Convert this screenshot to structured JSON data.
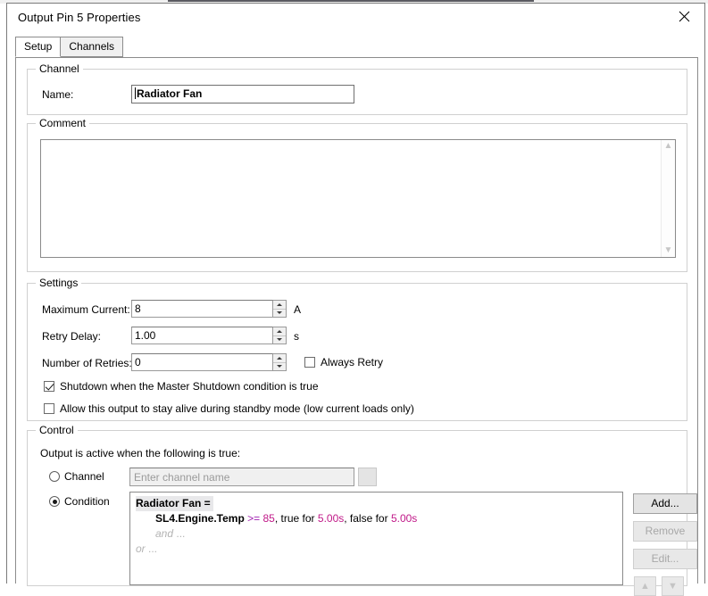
{
  "window": {
    "title": "Output Pin 5 Properties",
    "close_icon": "close-icon"
  },
  "tabs": [
    {
      "label": "Setup",
      "active": true
    },
    {
      "label": "Channels",
      "active": false
    }
  ],
  "channel_group": {
    "legend": "Channel",
    "name_label": "Name:",
    "name_value": "Radiator Fan"
  },
  "comment_group": {
    "legend": "Comment",
    "value": "",
    "scroll_up_icon": "chevron-up-icon",
    "scroll_down_icon": "chevron-down-icon"
  },
  "settings_group": {
    "legend": "Settings",
    "max_current_label": "Maximum Current:",
    "max_current_value": "8",
    "max_current_unit": "A",
    "retry_delay_label": "Retry Delay:",
    "retry_delay_value": "1.00",
    "retry_delay_unit": "s",
    "retries_label": "Number of Retries:",
    "retries_value": "0",
    "always_retry_label": "Always Retry",
    "always_retry_checked": false,
    "master_shutdown_label": "Shutdown when the Master Shutdown condition is true",
    "master_shutdown_checked": true,
    "standby_label": "Allow this output to stay alive during standby mode (low current loads only)",
    "standby_checked": false
  },
  "control_group": {
    "legend": "Control",
    "hint": "Output is active when the following is true:",
    "channel_radio_label": "Channel",
    "channel_radio_selected": false,
    "channel_placeholder": "Enter channel name",
    "channel_value": "",
    "condition_radio_label": "Condition",
    "condition_radio_selected": true,
    "condition": {
      "header": "Radiator Fan =",
      "line1": {
        "channel": "SL4.Engine.Temp",
        "operator": ">=",
        "value": "85",
        "true_for_label": ", true for ",
        "true_for_value": "5.00s",
        "false_for_label": ", false for ",
        "false_for_value": "5.00s"
      },
      "and_placeholder": "and",
      "and_dots": "...",
      "or_placeholder": "or",
      "or_dots": "..."
    },
    "buttons": {
      "add": "Add...",
      "remove": "Remove",
      "edit": "Edit...",
      "move_up_icon": "move-up-icon",
      "move_down_icon": "move-down-icon"
    }
  },
  "colors": {
    "operator": "#a020b0",
    "number": "#c01888",
    "placeholder": "#b4b4b4"
  }
}
